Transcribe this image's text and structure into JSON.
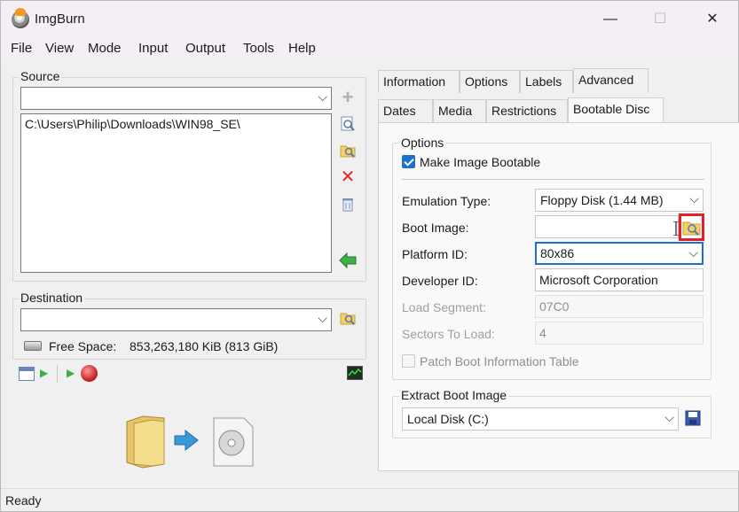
{
  "window": {
    "title": "ImgBurn",
    "minimize_glyph": "—",
    "maximize_glyph": "☐",
    "close_glyph": "✕"
  },
  "menu": [
    "File",
    "View",
    "Mode",
    "Input",
    "Output",
    "Tools",
    "Help"
  ],
  "source": {
    "label": "Source",
    "combo_value": "",
    "list_items": [
      "C:\\Users\\Philip\\Downloads\\WIN98_SE\\"
    ]
  },
  "destination": {
    "label": "Destination",
    "combo_value": "",
    "free_space_label": "Free Space:",
    "free_space_value": "853,263,180 KiB  (813 GiB)"
  },
  "tabs": {
    "row1": [
      "Information",
      "Options",
      "Labels",
      "Advanced"
    ],
    "row2": [
      "Dates",
      "Media",
      "Restrictions",
      "Bootable Disc"
    ]
  },
  "options": {
    "label": "Options",
    "make_bootable_label": "Make Image Bootable",
    "make_bootable_checked": true
  },
  "fields": {
    "emulation_type_label": "Emulation Type:",
    "emulation_type_value": "Floppy Disk (1.44 MB)",
    "boot_image_label": "Boot Image:",
    "boot_image_value": "",
    "platform_id_label": "Platform ID:",
    "platform_id_value": "80x86",
    "developer_id_label": "Developer ID:",
    "developer_id_value": "Microsoft Corporation",
    "load_segment_label": "Load Segment:",
    "load_segment_value": "07C0",
    "sectors_to_load_label": "Sectors To Load:",
    "sectors_to_load_value": "4",
    "patch_boot_label": "Patch Boot Information Table",
    "patch_boot_checked": false
  },
  "extract": {
    "label": "Extract Boot Image",
    "drive_value": "Local Disk (C:)"
  },
  "status": {
    "text": "Ready"
  },
  "icons": {
    "add": "+",
    "remove": "✕",
    "arrow_down": "⌵",
    "play": "▶"
  },
  "colors": {
    "highlight_box": "#e0202a",
    "accent_blue": "#1f6fcf"
  }
}
